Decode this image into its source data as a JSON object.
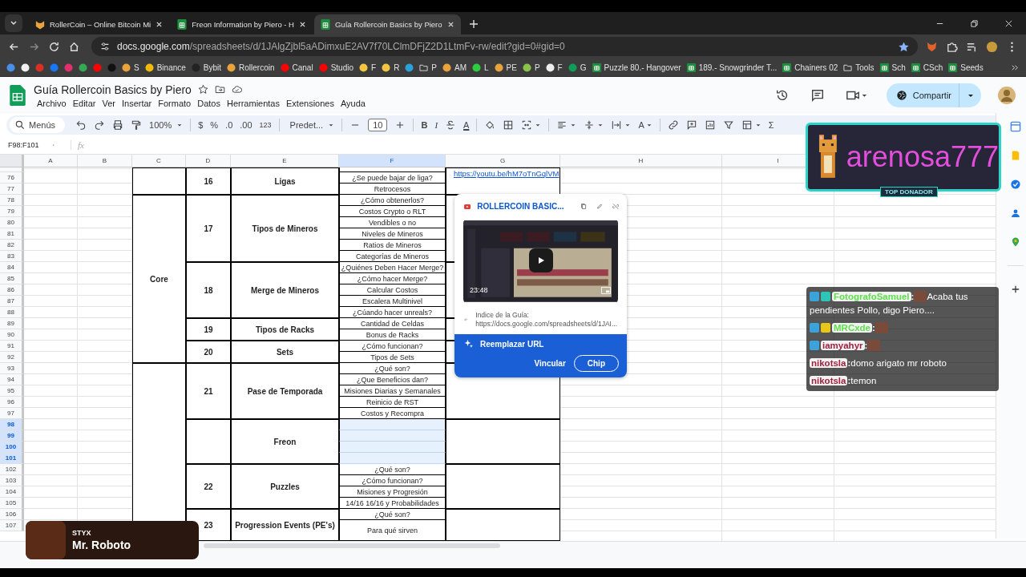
{
  "browser": {
    "tabs": [
      {
        "title": "RollerCoin – Online Bitcoin Mi",
        "kind": "game",
        "selected": false
      },
      {
        "title": "Freon Information by Piero - H",
        "kind": "sheets",
        "selected": false
      },
      {
        "title": "Guía Rollercoin Basics by Piero",
        "kind": "sheets",
        "selected": true
      }
    ],
    "url_host": "docs.google.com",
    "url_path": "/spreadsheets/d/1JAlgZjbl5aADimxuE2AV7f70LClmDFjZ2D1LtmFv-rw/edit?gid=0#gid=0",
    "bookmarks": [
      {
        "kind": "site",
        "color": "#4a8fe7"
      },
      {
        "kind": "site",
        "color": "#f1f1f1"
      },
      {
        "kind": "site",
        "color": "#d93025"
      },
      {
        "kind": "site",
        "color": "#1877f2"
      },
      {
        "kind": "site",
        "color": "#e1306c"
      },
      {
        "kind": "site",
        "color": "#34a853"
      },
      {
        "kind": "site",
        "color": "#ff0000"
      },
      {
        "kind": "site",
        "color": "#111111"
      },
      {
        "label": "S",
        "kind": "site",
        "color": "#e8a33d"
      },
      {
        "label": "Binance",
        "kind": "site",
        "color": "#f0b90b"
      },
      {
        "label": "Bybit",
        "kind": "site",
        "color": "#222222"
      },
      {
        "label": "Rollercoin",
        "kind": "site",
        "color": "#e8a33d"
      },
      {
        "label": "Canal",
        "kind": "site",
        "color": "#ff0000"
      },
      {
        "label": "Studio",
        "kind": "site",
        "color": "#ff0000"
      },
      {
        "label": "F",
        "kind": "site",
        "color": "#f4c542"
      },
      {
        "label": "R",
        "kind": "site",
        "color": "#f4c542"
      },
      {
        "kind": "site",
        "color": "#2aa1da"
      },
      {
        "label": "P",
        "kind": "folder"
      },
      {
        "label": "AM",
        "kind": "site",
        "color": "#e8a33d"
      },
      {
        "label": "L",
        "kind": "site",
        "color": "#2ecc40"
      },
      {
        "label": "PE",
        "kind": "site",
        "color": "#e8a33d"
      },
      {
        "label": "P",
        "kind": "site",
        "color": "#8bc34a"
      },
      {
        "label": "F",
        "kind": "site",
        "color": "#eeeeee"
      },
      {
        "label": "G",
        "kind": "site",
        "color": "#0f9d58"
      },
      {
        "label": "Puzzle 80.- Hangover",
        "kind": "sheets"
      },
      {
        "label": "189.- Snowgrinder T...",
        "kind": "sheets"
      },
      {
        "label": "Chainers 02",
        "kind": "sheets"
      },
      {
        "label": "Tools",
        "kind": "folder"
      },
      {
        "label": "Sch",
        "kind": "sheets"
      },
      {
        "label": "CSch",
        "kind": "sheets"
      },
      {
        "label": "Seeds",
        "kind": "sheets"
      }
    ]
  },
  "doc": {
    "title": "Guía Rollercoin Basics by Piero",
    "menus": [
      "Archivo",
      "Editar",
      "Ver",
      "Insertar",
      "Formato",
      "Datos",
      "Herramientas",
      "Extensiones",
      "Ayuda"
    ],
    "share": "Compartir"
  },
  "toolbar": {
    "search": "Menús",
    "zoom": "100%",
    "currency": "$",
    "percent": "%",
    "decimal_less": ".0",
    "decimal_more": ".00",
    "number_format": "123",
    "font": "Predet...",
    "font_size": "10",
    "bold": "B",
    "italic": "I",
    "text_color": "A",
    "rotation": "A",
    "functions": "Σ"
  },
  "sheet": {
    "name_box": "F98:F101",
    "fx": "fx",
    "columns": [
      {
        "label": "A",
        "selected": false
      },
      {
        "label": "B",
        "selected": false
      },
      {
        "label": "C",
        "selected": false
      },
      {
        "label": "D",
        "selected": false
      },
      {
        "label": "E",
        "selected": false
      },
      {
        "label": "F",
        "selected": true
      },
      {
        "label": "G",
        "selected": false
      },
      {
        "label": "H",
        "selected": false
      },
      {
        "label": "I",
        "selected": false
      }
    ],
    "rows": [
      {
        "label": "76",
        "selected": false
      },
      {
        "label": "77",
        "selected": false
      },
      {
        "label": "78",
        "selected": false
      },
      {
        "label": "79",
        "selected": false
      },
      {
        "label": "80",
        "selected": false
      },
      {
        "label": "81",
        "selected": false
      },
      {
        "label": "82",
        "selected": false
      },
      {
        "label": "83",
        "selected": false
      },
      {
        "label": "84",
        "selected": false
      },
      {
        "label": "85",
        "selected": false
      },
      {
        "label": "86",
        "selected": false
      },
      {
        "label": "87",
        "selected": false
      },
      {
        "label": "88",
        "selected": false
      },
      {
        "label": "89",
        "selected": false
      },
      {
        "label": "90",
        "selected": false
      },
      {
        "label": "91",
        "selected": false
      },
      {
        "label": "92",
        "selected": false
      },
      {
        "label": "93",
        "selected": false
      },
      {
        "label": "94",
        "selected": false
      },
      {
        "label": "95",
        "selected": false
      },
      {
        "label": "96",
        "selected": false
      },
      {
        "label": "97",
        "selected": false
      },
      {
        "label": "98",
        "selected": true
      },
      {
        "label": "99",
        "selected": true
      },
      {
        "label": "100",
        "selected": true
      },
      {
        "label": "101",
        "selected": true
      },
      {
        "label": "102",
        "selected": false
      },
      {
        "label": "103",
        "selected": false
      },
      {
        "label": "104",
        "selected": false
      },
      {
        "label": "105",
        "selected": false
      },
      {
        "label": "106",
        "selected": false
      },
      {
        "label": "107",
        "selected": false
      }
    ],
    "categories": [
      {
        "topics": [
          {
            "number": "16",
            "title": "Ligas",
            "link": "https://youtu.be/hM7oTnGqlVM",
            "items": [
              {
                "text": "¿Se puede bajar de liga?",
                "selected": false
              },
              {
                "text": "Retrocesos",
                "selected": false
              }
            ]
          }
        ]
      },
      {
        "label": "Core",
        "topics": [
          {
            "number": "17",
            "title": "Tipos de Mineros",
            "items": [
              {
                "text": "¿Cómo obtenerlos?",
                "selected": false
              },
              {
                "text": "Costos Crypto o RLT",
                "selected": false
              },
              {
                "text": "Vendibles o no",
                "selected": false
              },
              {
                "text": "Niveles de Mineros",
                "selected": false
              },
              {
                "text": "Ratios de Mineros",
                "selected": false
              },
              {
                "text": "Categorías de Mineros",
                "selected": false
              }
            ]
          },
          {
            "number": "18",
            "title": "Merge de Mineros",
            "items": [
              {
                "text": "¿Quiénes Deben Hacer Merge?",
                "selected": false
              },
              {
                "text": "¿Cómo hacer Merge?",
                "selected": false
              },
              {
                "text": "Calcular Costos",
                "selected": false
              },
              {
                "text": "Escalera Multinivel",
                "selected": false
              },
              {
                "text": "¿Cúando hacer unreals?",
                "selected": false
              }
            ]
          },
          {
            "number": "19",
            "title": "Tipos de Racks",
            "items": [
              {
                "text": "Cantidad de Celdas",
                "selected": false
              },
              {
                "text": "Bonus de Racks",
                "selected": false
              }
            ]
          },
          {
            "number": "20",
            "title": "Sets",
            "items": [
              {
                "text": "¿Cómo funcionan?",
                "selected": false
              },
              {
                "text": "Tipos de Sets",
                "selected": false
              }
            ]
          }
        ]
      },
      {
        "topics": [
          {
            "number": "21",
            "title": "Pase de Temporada",
            "items": [
              {
                "text": "¿Qué son?",
                "selected": false
              },
              {
                "text": "¿Que Beneficios dan?",
                "selected": false
              },
              {
                "text": "Misiones Diarias y Semanales",
                "selected": false
              },
              {
                "text": "Reinicio de RST",
                "selected": false
              },
              {
                "text": "Costos y Recompra",
                "selected": false
              }
            ]
          },
          {
            "title": "Freon",
            "items": [
              {
                "selected": true
              },
              {
                "selected": true
              },
              {
                "selected": true
              },
              {
                "selected": true
              }
            ]
          },
          {
            "number": "22",
            "title": "Puzzles",
            "items": [
              {
                "text": "¿Qué son?",
                "selected": false
              },
              {
                "text": "¿Cómo funcionan?",
                "selected": false
              },
              {
                "text": "Misiones y Progresión",
                "selected": false
              },
              {
                "text": "14/16 16/16 y Probabilidades",
                "selected": false
              }
            ]
          },
          {
            "number": "23",
            "title": "Progression Events (PE's)",
            "items": [
              {
                "text": "¿Qué son?",
                "selected": false
              },
              {
                "text": "Para qué sirven",
                "selected": false
              }
            ]
          }
        ]
      }
    ]
  },
  "link_card": {
    "title": "ROLLERCOIN BASIC...",
    "duration": "23:48",
    "description": "Indice de la Guía:",
    "url": "https://docs.google.com/spreadsheets/d/1JAI...",
    "replace": "Reemplazar URL",
    "link_action": "Vincular",
    "chip_action": "Chip"
  },
  "donor_banner": {
    "name": "arenosa777",
    "caption": "TOP DONADOR"
  },
  "chat": [
    {
      "badges": [
        {
          "color": "#3ba3d9"
        },
        {
          "color": "#2ec4b6"
        }
      ],
      "user": "FotografoSamuel",
      "color": "#5ee04a",
      "separator": ":",
      "emote": true,
      "text": "Acaba tus pendientes Pollo, digo Piero...."
    },
    {
      "badges": [
        {
          "color": "#3ba3d9"
        },
        {
          "color": "#e6c619"
        }
      ],
      "user": "MRCxde",
      "color": "#5ee04a",
      "separator": ":",
      "emote": true
    },
    {
      "badges": [
        {
          "color": "#3ba3d9"
        }
      ],
      "user": "iamyahyr",
      "color": "#a3213e",
      "separator": ":",
      "emote": true
    },
    {
      "user": "nikotsla",
      "color": "#a3213e",
      "separator": ":",
      "emote": false,
      "text": "domo arigato mr roboto"
    },
    {
      "user": "nikotsla",
      "color": "#a3213e",
      "separator": ":",
      "emote": false,
      "text": "temon"
    }
  ],
  "now_playing": {
    "artist": "STYX",
    "song": "Mr. Roboto"
  }
}
